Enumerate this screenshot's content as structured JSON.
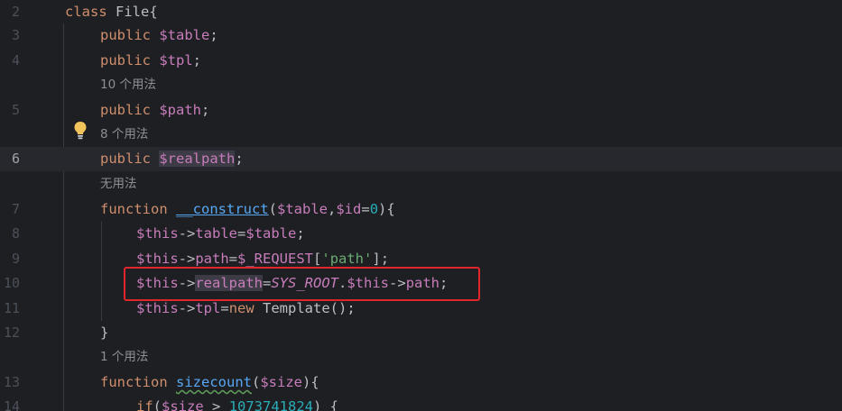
{
  "line_numbers": {
    "l2": "2",
    "l3": "3",
    "l4": "4",
    "l5": "5",
    "l6": "6",
    "l7": "7",
    "l8": "8",
    "l9": "9",
    "l10": "10",
    "l11": "11",
    "l12": "12",
    "l13": "13",
    "l14": "14"
  },
  "hints": {
    "tpl_usages": "10 个用法",
    "path_usages": "8 个用法",
    "realpath_usages": "无用法",
    "sizecount_usages": "1 个用法"
  },
  "tokens": {
    "class_kw": "class",
    "class_name": " File{",
    "public": "public",
    "table_var": " $table",
    "tpl_var": " $tpl",
    "path_var": " $path",
    "realpath_var": "$realpath",
    "semicolon": ";",
    "function_kw": "function",
    "construct_name": "__construct",
    "construct_params_open": "(",
    "table_param": "$table",
    "comma": ",",
    "id_param": "$id",
    "equals": "=",
    "zero": "0",
    "params_close": "){",
    "this": "$this",
    "arrow": "->",
    "table_prop": "table",
    "table_assign": "$table",
    "path_prop": "path",
    "request": "$_REQUEST",
    "bracket_open": "[",
    "path_key": "'path'",
    "bracket_close": "];",
    "realpath_prop": "realpath",
    "sys_root": "SYS_ROOT",
    "dot": ".",
    "tpl_prop": "tpl",
    "new_kw": "new",
    "template_call": " Template();",
    "close_brace": "}",
    "sizecount_name": "sizecount",
    "size_param": "$size",
    "if_kw": "if",
    "if_open": "(",
    "size_var": "$size",
    "gt": " > ",
    "big_num": "1073741824",
    "if_close": ") {"
  },
  "icons": {
    "intention_bulb": "lightbulb-icon"
  },
  "colors": {
    "background": "#1e1f22",
    "keyword": "#cf8e6d",
    "variable": "#c77dbb",
    "function": "#56a8f5",
    "string": "#6aab73",
    "number": "#2aacb8",
    "highlight_box": "#e0262c"
  }
}
